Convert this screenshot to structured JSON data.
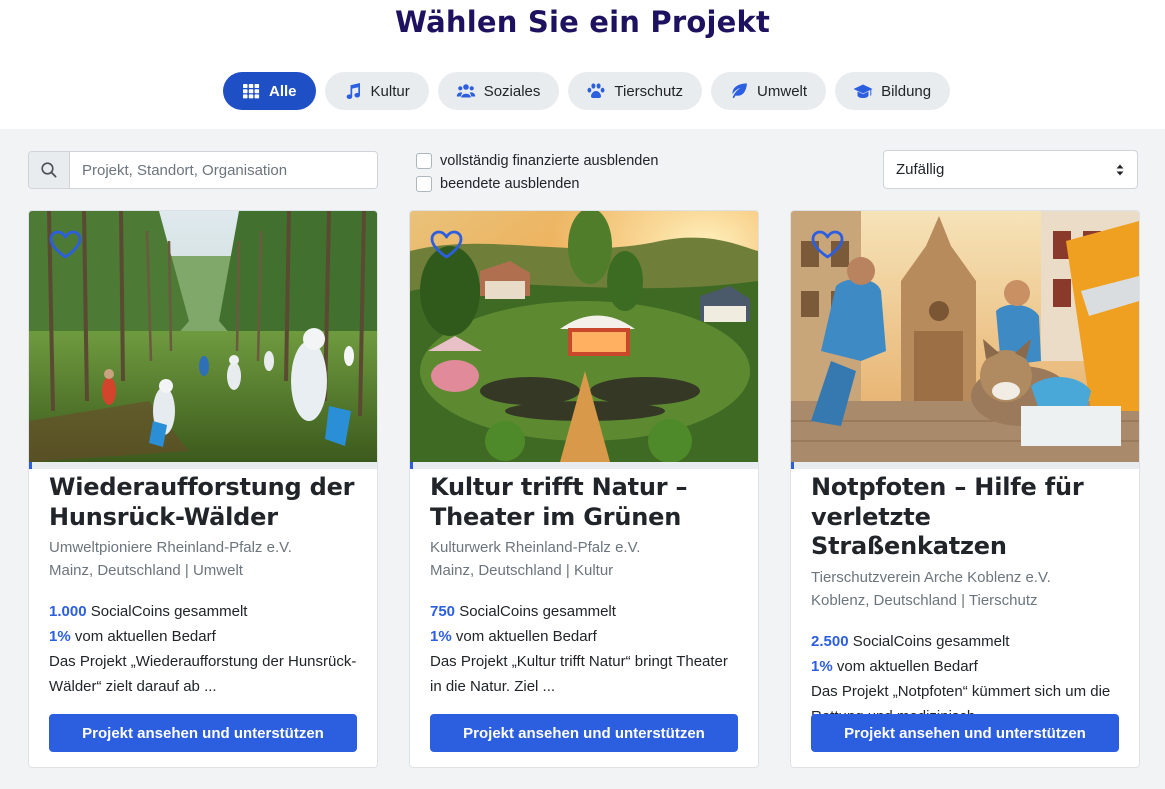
{
  "page": {
    "title": "Wählen Sie ein Projekt"
  },
  "filters": [
    {
      "label": "Alle",
      "icon": "grid-icon",
      "active": true
    },
    {
      "label": "Kultur",
      "icon": "music-note-icon",
      "active": false
    },
    {
      "label": "Soziales",
      "icon": "people-icon",
      "active": false
    },
    {
      "label": "Tierschutz",
      "icon": "paw-icon",
      "active": false
    },
    {
      "label": "Umwelt",
      "icon": "leaf-icon",
      "active": false
    },
    {
      "label": "Bildung",
      "icon": "graduation-cap-icon",
      "active": false
    }
  ],
  "toolbar": {
    "search_placeholder": "Projekt, Standort, Organisation",
    "check_funded_label": "vollständig finanzierte ausblenden",
    "check_ended_label": "beendete ausblenden",
    "sort_value": "Zufällig"
  },
  "colors": {
    "accent": "#2c5ee0",
    "title": "#1e1260",
    "active_pill": "#1f4fc4"
  },
  "cards": [
    {
      "title": "Wiederaufforstung der Hunsrück-Wälder",
      "organization": "Umweltpioniere Rheinland-Pfalz e.V.",
      "location": "Mainz, Deutschland",
      "category": "Umwelt",
      "coins": "1.000",
      "coins_label": "SocialCoins gesammelt",
      "percent": "1%",
      "percent_label": "vom aktuellen Bedarf",
      "description": "Das Projekt „Wiederaufforstung der Hunsrück-Wälder“ zielt darauf ab ...",
      "button": "Projekt ansehen und unterstützen",
      "progress_fraction": 0.01,
      "image": "forest-cleanup-image"
    },
    {
      "title": "Kultur trifft Natur – Theater im Grünen",
      "organization": "Kulturwerk Rheinland-Pfalz e.V.",
      "location": "Mainz, Deutschland",
      "category": "Kultur",
      "coins": "750",
      "coins_label": "SocialCoins gesammelt",
      "percent": "1%",
      "percent_label": "vom aktuellen Bedarf",
      "description": "Das Projekt „Kultur trifft Natur“ bringt Theater in die Natur. Ziel ...",
      "button": "Projekt ansehen und unterstützen",
      "progress_fraction": 0.01,
      "image": "open-air-theater-image"
    },
    {
      "title": "Notpfoten – Hilfe für verletzte Straßenkatzen",
      "organization": "Tierschutzverein Arche Koblenz e.V.",
      "location": "Koblenz, Deutschland",
      "category": "Tierschutz",
      "coins": "2.500",
      "coins_label": "SocialCoins gesammelt",
      "percent": "1%",
      "percent_label": "vom aktuellen Bedarf",
      "description": "Das Projekt „Notpfoten“ kümmert sich um die Rettung und medizinisch ...",
      "button": "Projekt ansehen und unterstützen",
      "progress_fraction": 0.01,
      "image": "cat-rescue-image"
    }
  ]
}
